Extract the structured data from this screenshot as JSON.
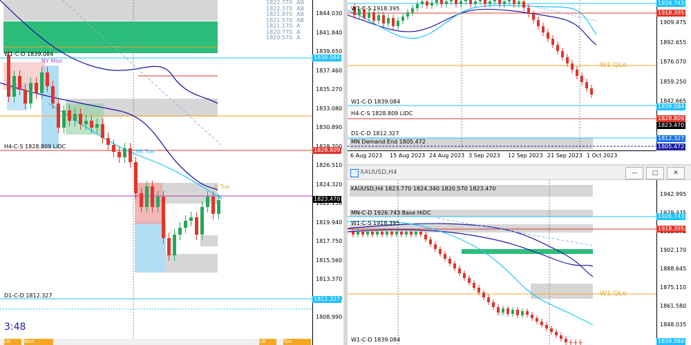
{
  "colors": {
    "up": "#26a65b",
    "down": "#e0352b",
    "green_zone": "#2dbd7b",
    "grey_zone": "#d6d6d6",
    "light_blue": "#1ec0ff",
    "navy": "#1a1aa6",
    "orange": "#f5a623",
    "red_level": "#e0352b",
    "blue_box": "#1a73e8",
    "navy_box": "#1a1aa6"
  },
  "left_chart": {
    "price_ticks": [
      "1844.030",
      "1841.840",
      "1839.650",
      "1837.460",
      "1835.270",
      "1833.080",
      "1830.890",
      "1828.700",
      "1826.510",
      "1824.320",
      "1822.130",
      "1819.940",
      "1817.750",
      "1815.560",
      "1813.370",
      "1811.180",
      "1808.990"
    ],
    "boxes": {
      "w1": "1839.084",
      "h4": "1828.809",
      "current": "1823.470",
      "d1": "1812.327"
    },
    "level_labels": {
      "w1": "W1-C-D 1839.084",
      "h4": "H4-C-S 1828.809 LiDC",
      "d1": "D1-C-D 1812.327"
    },
    "session_labels": {
      "ny_mon": "NY Mon",
      "hk_tue": "HK Tue",
      "ny_tue": "N Tue"
    },
    "top_right_list": {
      "prices": [
        "1822.770",
        "1822.370",
        "1821.970",
        "1821.570",
        "1821.170",
        "1820.770",
        "1820.570"
      ],
      "tags": [
        "AB",
        "AB",
        "AB",
        "AB",
        "A",
        "A",
        "A"
      ]
    },
    "countdown": "3:48",
    "bottom_tags": [
      "LN",
      "Mon",
      "LN",
      "Tue"
    ]
  },
  "top_right_chart": {
    "price_ticks": [
      "1909.475",
      "1892.655",
      "1876.070",
      "1859.250",
      "1842.665"
    ],
    "boxes": {
      "mn": "1926.743",
      "w1_red": "1918.395",
      "w1": "1839.084",
      "h4": "1828.809",
      "current": "1823.470",
      "d1": "1812.327",
      "mn_demand": "1805.472"
    },
    "level_labels": {
      "w1s": "W1-C-S 1918.395",
      "w1": "W1-C-D 1839.084",
      "h4": "H4-C-S 1828.809 LiDC",
      "d1": "D1-C-D 1812.327",
      "mn_demand": "MN Demand End 1805.472",
      "w1_qlo": "W1 QLo",
      "top_partial": "MN-C-D 1926.743 Base HiDC"
    },
    "date_ticks": [
      "6 Aug 2023",
      "15 Aug 2023",
      "24 Aug 2023",
      "3 Sep 2023",
      "12 Sep 2023",
      "21 Sep 2023",
      "1 Oct 2023"
    ]
  },
  "bottom_right_chart": {
    "window_title": "XAUUSD,H4",
    "symbol_line": "XAUUSD,H4  1823.770 1824.340 1820.570 1823.470",
    "price_ticks": [
      "1942.995",
      "1929.435",
      "1915.875",
      "1902.170",
      "1888.645",
      "1875.110",
      "1861.580",
      "1848.035"
    ],
    "boxes": {
      "mn": "1926.743",
      "w1_red": "1918.395",
      "w1": "1839.084"
    },
    "level_labels": {
      "mn": "MN-C-D 1926.743 Base HiDC",
      "w1s": "W1-C-S 1918.395",
      "w1": "W1-C-D 1839.084",
      "w1_qlo": "W1 QLo"
    }
  }
}
